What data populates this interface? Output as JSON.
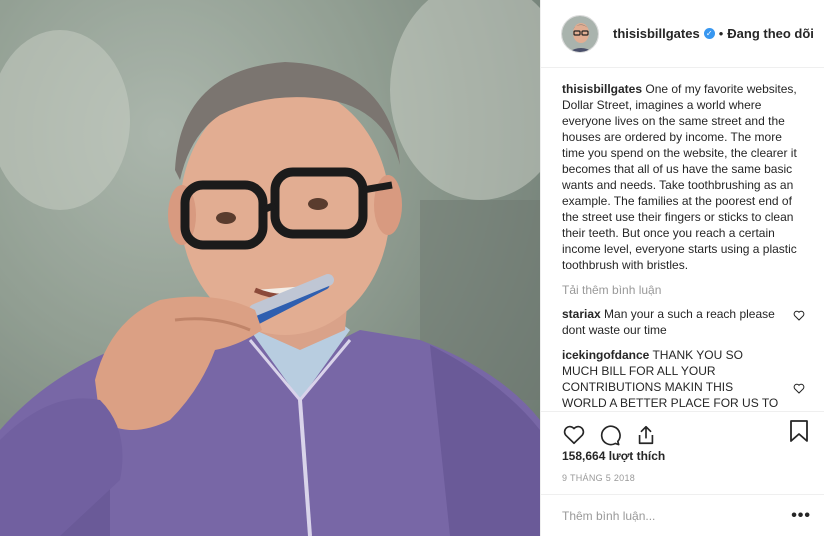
{
  "header": {
    "username": "thisisbillgates",
    "verified_icon": "verified-check-icon",
    "separator": "•",
    "follow_status": "Đang theo dõi"
  },
  "caption": {
    "username": "thisisbillgates",
    "text": " One of my favorite websites, Dollar Street, imagines a world where everyone lives on the same street and the houses are ordered by income. The more time you spend on the website, the clearer it becomes that all of us have the same basic wants and needs. Take toothbrushing as an example. The families at the poorest end of the street use their fingers or sticks to clean their teeth. But once you reach a certain income level, everyone starts using a plastic toothbrush with bristles."
  },
  "load_more_label": "Tải thêm bình luận",
  "comments": [
    {
      "username": "stariax",
      "text": " Man your a such a reach please dont waste our time"
    },
    {
      "username": "icekingofdance",
      "text": " THANK YOU SO MUCH BILL FOR ALL YOUR CONTRIBUTIONS MAKIN THIS WORLD A BETTER PLACE FOR US TO ALL THRIVE FOR A BETTER EXISTANCE"
    }
  ],
  "actions": {
    "like_icon": "heart-icon",
    "comment_icon": "comment-bubble-icon",
    "share_icon": "share-icon",
    "save_icon": "bookmark-icon"
  },
  "likes_label": "158,664 lượt thích",
  "date_label": "9 THÁNG 5 2018",
  "add_comment": {
    "placeholder": "Thêm bình luận...",
    "more_icon": "more-options-icon",
    "more_label": "•••"
  },
  "colors": {
    "accent": "#3897f0",
    "text": "#262626",
    "muted": "#999999",
    "border": "#efefef",
    "sweater": "#7b6aa8"
  }
}
